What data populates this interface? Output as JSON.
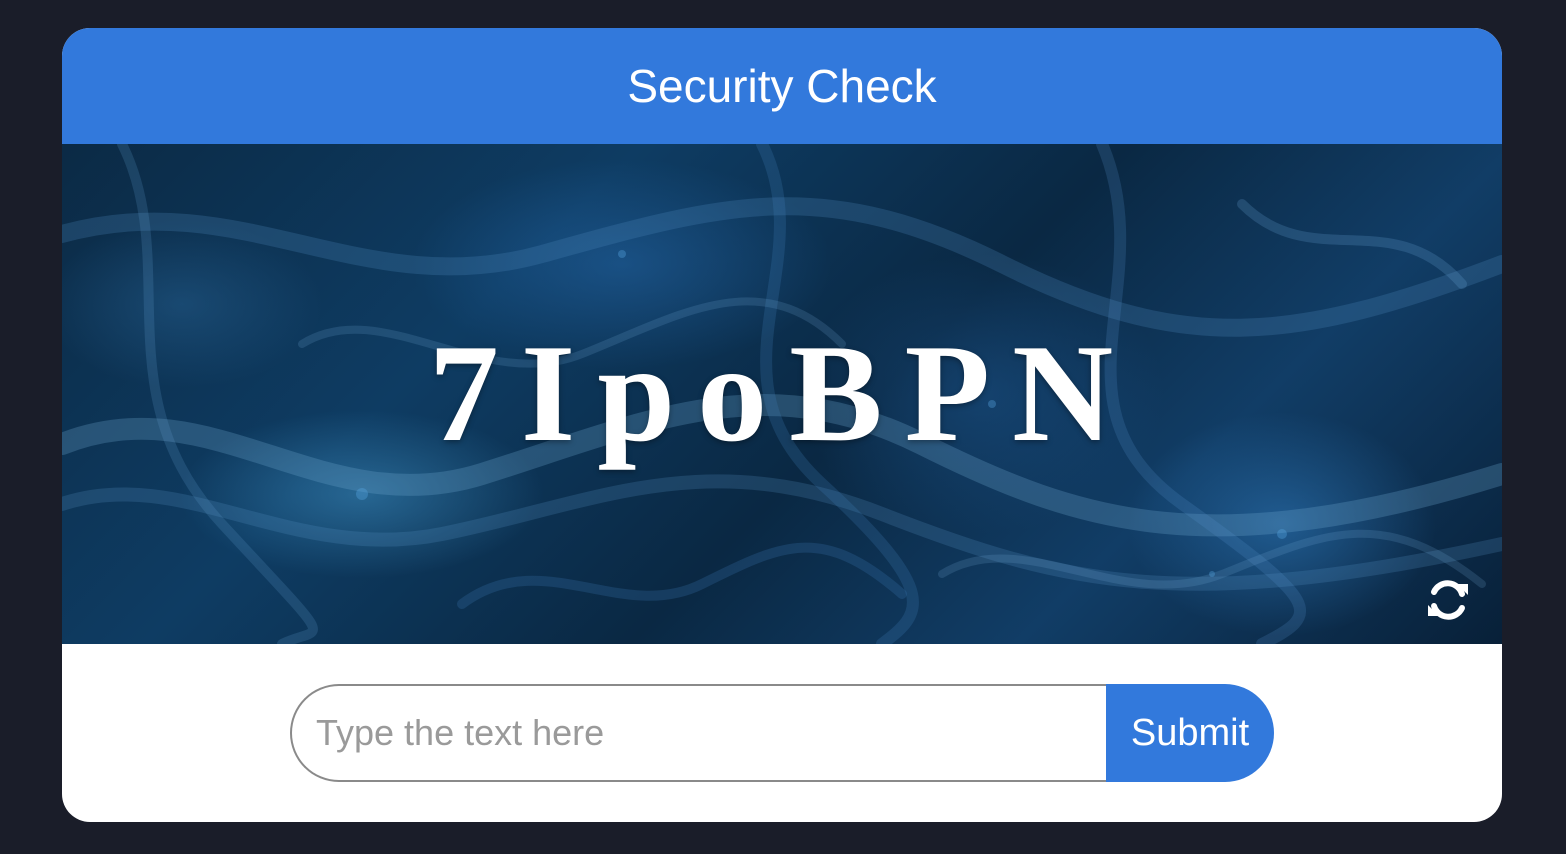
{
  "header": {
    "title": "Security Check"
  },
  "captcha": {
    "text": "7IpoBPN",
    "refresh_icon": "refresh-icon"
  },
  "form": {
    "input_placeholder": "Type the text here",
    "input_value": "",
    "submit_label": "Submit"
  },
  "colors": {
    "accent": "#3279dc",
    "page_background": "#1a1d29",
    "card_background": "#ffffff"
  }
}
